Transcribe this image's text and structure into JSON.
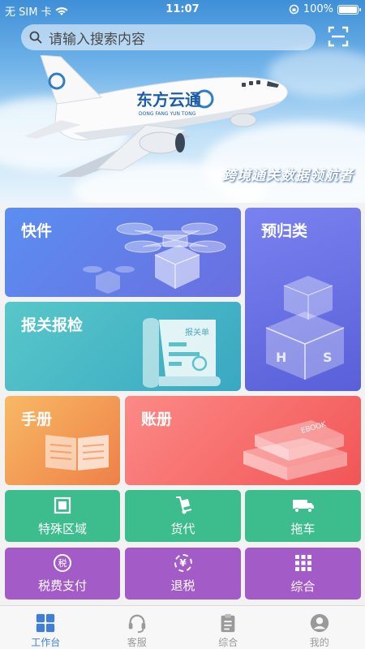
{
  "status": {
    "carrier": "无 SIM 卡",
    "time": "11:07",
    "battery": "100%",
    "battery_level": 1.0
  },
  "search": {
    "placeholder": "请输入搜索内容"
  },
  "banner": {
    "logo_text": "东方云通",
    "logo_sub": "DONG FANG YUN TONG",
    "slogan": "跨境通关数据领航者"
  },
  "tiles": {
    "express": "快件",
    "preclass": "预归类",
    "declare": "报关报检",
    "declare_doc": "报关单",
    "handbook": "手册",
    "ledger": "账册",
    "ledger_book": "EBOOK"
  },
  "services": [
    {
      "label": "特殊区域",
      "icon": "square-zone-icon"
    },
    {
      "label": "货代",
      "icon": "hand-truck-icon"
    },
    {
      "label": "拖车",
      "icon": "truck-icon"
    },
    {
      "label": "税费支付",
      "icon": "tax-icon"
    },
    {
      "label": "退税",
      "icon": "yuan-refund-icon"
    },
    {
      "label": "综合",
      "icon": "grid-dots-icon"
    }
  ],
  "services_glyphs": {
    "tax": "税",
    "refund": "¥"
  },
  "tabs": [
    {
      "label": "工作台",
      "icon": "grid-icon",
      "active": true
    },
    {
      "label": "客服",
      "icon": "headset-icon",
      "active": false
    },
    {
      "label": "综合",
      "icon": "clipboard-icon",
      "active": false
    },
    {
      "label": "我的",
      "icon": "user-icon",
      "active": false
    }
  ],
  "colors": {
    "accent": "#3f7fd9",
    "green": "#3dbd8d",
    "purple": "#a35bc8"
  }
}
